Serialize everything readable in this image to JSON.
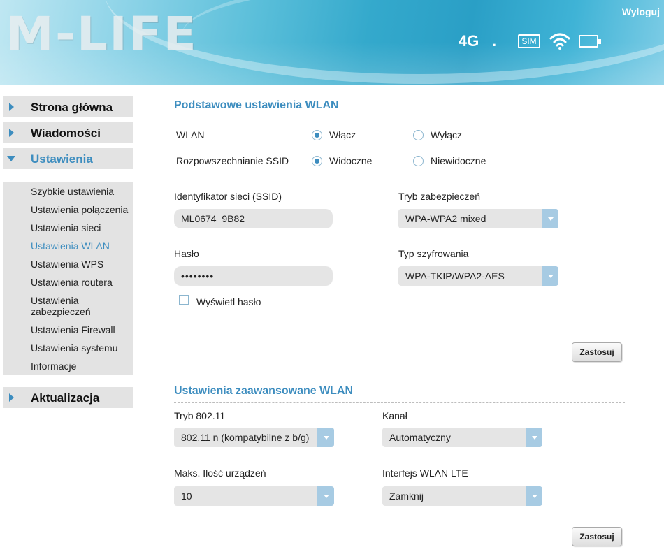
{
  "header": {
    "logo_text": "M-LIFE",
    "logout_label": "Wyloguj",
    "network_type": "4G",
    "signal_indicator": ".",
    "sim_label": "SIM"
  },
  "sidebar": {
    "items": [
      {
        "label": "Strona główna"
      },
      {
        "label": "Wiadomości"
      },
      {
        "label": "Ustawienia"
      },
      {
        "label": "Aktualizacja"
      }
    ],
    "submenu": [
      {
        "label": "Szybkie ustawienia"
      },
      {
        "label": "Ustawienia połączenia"
      },
      {
        "label": "Ustawienia sieci"
      },
      {
        "label": "Ustawienia WLAN"
      },
      {
        "label": "Ustawienia WPS"
      },
      {
        "label": "Ustawienia routera"
      },
      {
        "label": "Ustawienia zabezpieczeń"
      },
      {
        "label": "Ustawienia Firewall"
      },
      {
        "label": "Ustawienia systemu"
      },
      {
        "label": "Informacje"
      }
    ]
  },
  "basic": {
    "title": "Podstawowe ustawienia WLAN",
    "wlan_label": "WLAN",
    "wlan_on": "Włącz",
    "wlan_off": "Wyłącz",
    "ssid_broadcast_label": "Rozpowszechnianie SSID",
    "visible": "Widoczne",
    "invisible": "Niewidoczne",
    "ssid_label": "Identyfikator sieci (SSID)",
    "ssid_value": "ML0674_9B82",
    "security_mode_label": "Tryb zabezpieczeń",
    "security_mode_value": "WPA-WPA2 mixed",
    "password_label": "Hasło",
    "password_value": "••••••••",
    "encryption_label": "Typ szyfrowania",
    "encryption_value": "WPA-TKIP/WPA2-AES",
    "show_password_label": "Wyświetl hasło",
    "apply_label": "Zastosuj"
  },
  "advanced": {
    "title": "Ustawienia zaawansowane WLAN",
    "mode_label": "Tryb 802.11",
    "mode_value": "802.11 n (kompatybilne z b/g)",
    "channel_label": "Kanał",
    "channel_value": "Automatyczny",
    "max_devices_label": "Maks. Ilość urządzeń",
    "max_devices_value": "10",
    "lte_interface_label": "Interfejs WLAN LTE",
    "lte_interface_value": "Zamknij",
    "apply_label": "Zastosuj"
  },
  "colors": {
    "accent": "#3d8dbf",
    "sidebar_bg": "#e3e3e3",
    "field_bg": "#e5e5e5",
    "select_button": "#a7cbe3"
  }
}
